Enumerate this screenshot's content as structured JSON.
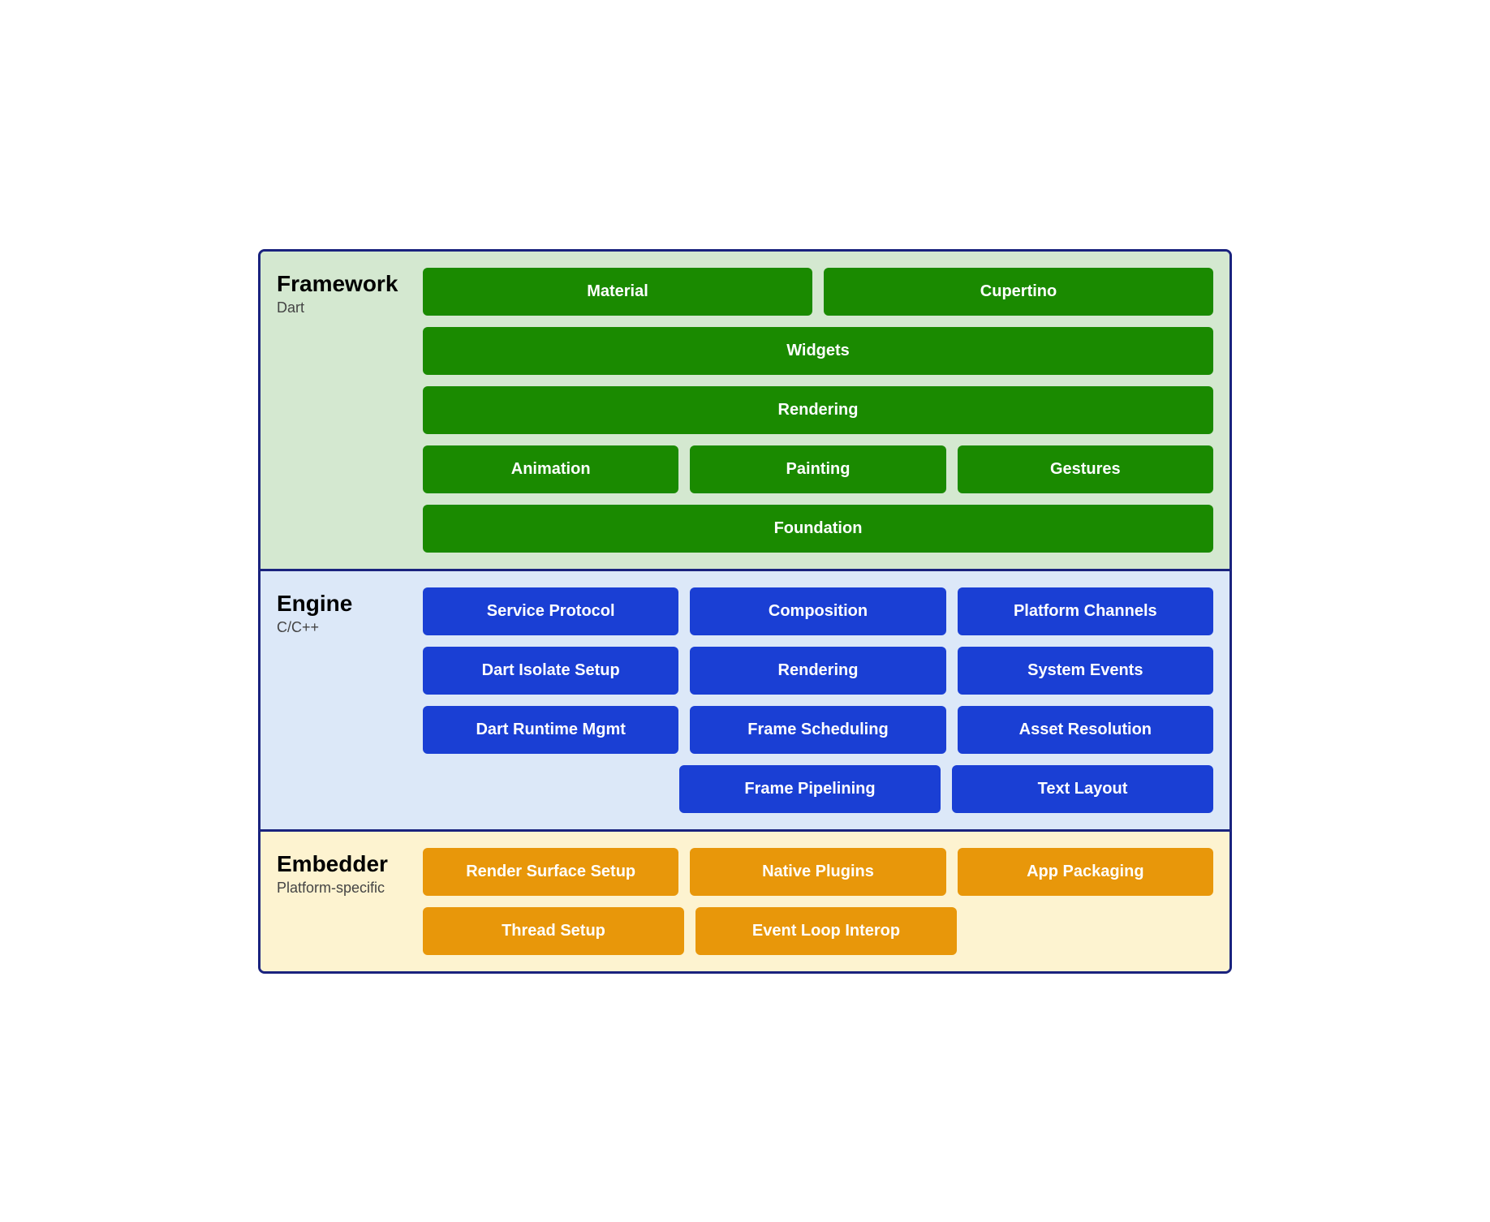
{
  "layers": [
    {
      "id": "framework",
      "title": "Framework",
      "subtitle": "Dart",
      "colorClass": "layer-framework",
      "btnClass": "btn-green",
      "rows": [
        [
          "Material",
          "Cupertino"
        ],
        [
          "Widgets"
        ],
        [
          "Rendering"
        ],
        [
          "Animation",
          "Painting",
          "Gestures"
        ],
        [
          "Foundation"
        ]
      ]
    },
    {
      "id": "engine",
      "title": "Engine",
      "subtitle": "C/C++",
      "colorClass": "layer-engine",
      "btnClass": "btn-blue",
      "rows": [
        [
          "Service Protocol",
          "Composition",
          "Platform Channels"
        ],
        [
          "Dart Isolate Setup",
          "Rendering",
          "System Events"
        ],
        [
          "Dart Runtime Mgmt",
          "Frame Scheduling",
          "Asset Resolution"
        ],
        [
          "",
          "Frame Pipelining",
          "Text Layout"
        ]
      ]
    },
    {
      "id": "embedder",
      "title": "Embedder",
      "subtitle": "Platform-specific",
      "colorClass": "layer-embedder",
      "btnClass": "btn-orange",
      "rows": [
        [
          "Render Surface Setup",
          "Native Plugins",
          "App Packaging"
        ],
        [
          "Thread Setup",
          "Event Loop Interop",
          ""
        ]
      ]
    }
  ]
}
